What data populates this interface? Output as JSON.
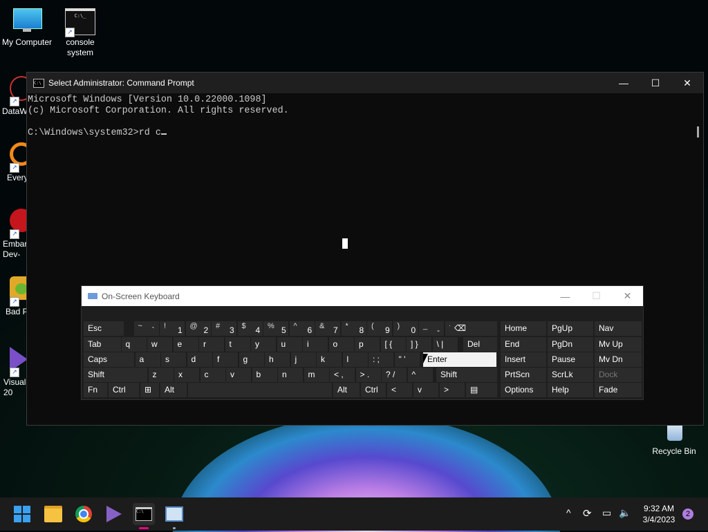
{
  "desktop": {
    "icons": [
      {
        "label": "My Computer"
      },
      {
        "label": "console system"
      },
      {
        "label": "DataW"
      },
      {
        "label": "Every"
      },
      {
        "label": "Embar Dev-"
      },
      {
        "label": "Bad P"
      },
      {
        "label": "Visual 20"
      },
      {
        "label": "Recycle Bin"
      }
    ]
  },
  "cmd": {
    "title": "Select Administrator: Command Prompt",
    "lines": [
      "Microsoft Windows [Version 10.0.22000.1098]",
      "(c) Microsoft Corporation. All rights reserved.",
      "",
      "C:\\Windows\\system32>rd c"
    ],
    "controls": {
      "minimize": "—",
      "maximize": "☐",
      "close": "✕"
    }
  },
  "osk": {
    "title": "On-Screen Keyboard",
    "row1": [
      {
        "shift": "",
        "main": "Esc"
      },
      {
        "shift": "~",
        "main": "`"
      },
      {
        "shift": "!",
        "main": "1"
      },
      {
        "shift": "@",
        "main": "2"
      },
      {
        "shift": "#",
        "main": "3"
      },
      {
        "shift": "$",
        "main": "4"
      },
      {
        "shift": "%",
        "main": "5"
      },
      {
        "shift": "^",
        "main": "6"
      },
      {
        "shift": "&",
        "main": "7"
      },
      {
        "shift": "*",
        "main": "8"
      },
      {
        "shift": "(",
        "main": "9"
      },
      {
        "shift": ")",
        "main": "0"
      },
      {
        "shift": "_",
        "main": "-"
      },
      {
        "shift": "+",
        "main": "="
      },
      {
        "shift": "",
        "main": "⌫"
      }
    ],
    "row2": [
      "Tab",
      "q",
      "w",
      "e",
      "r",
      "t",
      "y",
      "u",
      "i",
      "o",
      "p",
      "[ {",
      "] }",
      "\\ |",
      "Del"
    ],
    "row3": [
      "Caps",
      "a",
      "s",
      "d",
      "f",
      "g",
      "h",
      "j",
      "k",
      "l",
      ": ;",
      "\" '",
      "Enter"
    ],
    "row4": [
      "Shift",
      "z",
      "x",
      "c",
      "v",
      "b",
      "n",
      "m",
      "< ,",
      "> .",
      "? /",
      "^",
      "Shift"
    ],
    "row5": [
      "Fn",
      "Ctrl",
      "⊞",
      "Alt",
      "",
      "Alt",
      "Ctrl",
      "<",
      "v",
      ">",
      "▤"
    ],
    "nav": {
      "col1": [
        "Home",
        "End",
        "Insert",
        "PrtScn",
        "Options"
      ],
      "col2": [
        "PgUp",
        "PgDn",
        "Pause",
        "ScrLk",
        "Help"
      ],
      "col3": [
        "Nav",
        "Mv Up",
        "Mv Dn",
        "Dock",
        "Fade"
      ]
    }
  },
  "taskbar": {
    "apps": [
      "windows-start",
      "file-explorer",
      "chrome",
      "visual-studio",
      "command-prompt",
      "remote-desktop"
    ],
    "time": "9:32 AM",
    "date": "3/4/2023",
    "notifications": "2"
  }
}
